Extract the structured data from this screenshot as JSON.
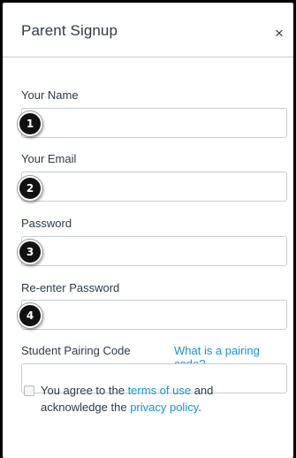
{
  "dialog": {
    "title": "Parent Signup",
    "close_glyph": "×"
  },
  "fields": {
    "name": {
      "label": "Your Name",
      "value": "",
      "marker": "1"
    },
    "email": {
      "label": "Your Email",
      "value": "",
      "marker": "2"
    },
    "password": {
      "label": "Password",
      "value": "",
      "marker": "3"
    },
    "confirm_password": {
      "label": "Re-enter Password",
      "value": "",
      "marker": "4"
    },
    "pairing_code": {
      "label": "Student Pairing Code",
      "value": "",
      "help_link": "What is a pairing code?"
    }
  },
  "agreement": {
    "prefix": "You agree to the ",
    "terms_link": "terms of use",
    "middle": " and acknowledge the ",
    "privacy_link": "privacy policy",
    "suffix": ".",
    "checked": false
  },
  "colors": {
    "link": "#1791d5",
    "text": "#2d3b45",
    "border": "#c7cdd1",
    "marker": "#111111"
  }
}
